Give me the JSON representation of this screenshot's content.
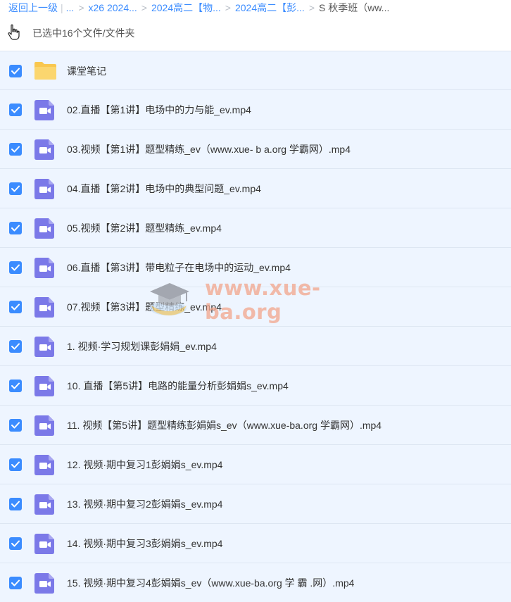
{
  "breadcrumb": {
    "back": "返回上一级",
    "bar": "|",
    "ellipsis": "...",
    "sep": ">",
    "items": [
      "x26 2024...",
      "2024高二【物...",
      "2024高二【彭..."
    ],
    "current": "S 秋季班（ww..."
  },
  "selection": {
    "text": "已选中16个文件/文件夹"
  },
  "files": [
    {
      "name": "课堂笔记",
      "type": "folder",
      "checked": true
    },
    {
      "name": "02.直播【第1讲】电场中的力与能_ev.mp4",
      "type": "video",
      "checked": true
    },
    {
      "name": "03.视频【第1讲】题型精练_ev（www.xue- b a.org 学霸网）.mp4",
      "type": "video",
      "checked": true
    },
    {
      "name": "04.直播【第2讲】电场中的典型问题_ev.mp4",
      "type": "video",
      "checked": true
    },
    {
      "name": "05.视频【第2讲】题型精练_ev.mp4",
      "type": "video",
      "checked": true
    },
    {
      "name": "06.直播【第3讲】带电粒子在电场中的运动_ev.mp4",
      "type": "video",
      "checked": true
    },
    {
      "name": "07.视频【第3讲】题型精练_ev.mp4",
      "type": "video",
      "checked": true
    },
    {
      "name": "1. 视频·学习规划课彭娟娟_ev.mp4",
      "type": "video",
      "checked": true
    },
    {
      "name": "10. 直播【第5讲】电路的能量分析彭娟娟s_ev.mp4",
      "type": "video",
      "checked": true
    },
    {
      "name": "11. 视频【第5讲】题型精练彭娟娟s_ev（www.xue-ba.org 学霸网）.mp4",
      "type": "video",
      "checked": true
    },
    {
      "name": "12. 视频·期中复习1彭娟娟s_ev.mp4",
      "type": "video",
      "checked": true
    },
    {
      "name": "13. 视频·期中复习2彭娟娟s_ev.mp4",
      "type": "video",
      "checked": true
    },
    {
      "name": "14. 视频·期中复习3彭娟娟s_ev.mp4",
      "type": "video",
      "checked": true
    },
    {
      "name": "15. 视频·期中复习4彭娟娟s_ev（www.xue-ba.org 学 霸 .网）.mp4",
      "type": "video",
      "checked": true
    }
  ],
  "watermark": {
    "text": "www.xue-ba.org"
  },
  "colors": {
    "accent": "#3b8cff",
    "row_bg": "#eef5ff",
    "folder": "#f9c74f",
    "video": "#7b79e8"
  },
  "icons": {
    "cursor": "hand-pointer-icon",
    "folder": "folder-icon",
    "video": "video-file-icon",
    "check": "checkbox-checked-icon",
    "watermark": "graduation-cap-icon"
  }
}
